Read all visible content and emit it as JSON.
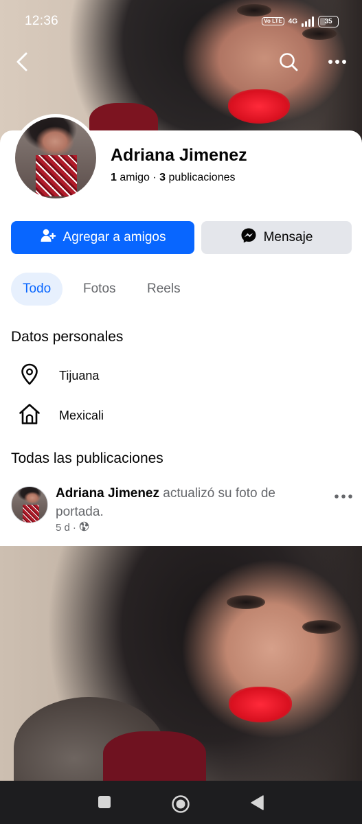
{
  "status_bar": {
    "time": "12:36",
    "volte": "Vo LTE",
    "network": "4G",
    "battery": "35",
    "battery_level": 0.35
  },
  "profile": {
    "name": "Adriana Jimenez",
    "friends_count": "1",
    "friends_label": "amigo",
    "separator": "·",
    "posts_count": "3",
    "posts_label": "publicaciones"
  },
  "actions": {
    "add_friend_label": "Agregar a amigos",
    "message_label": "Mensaje"
  },
  "tabs": [
    {
      "label": "Todo",
      "active": true
    },
    {
      "label": "Fotos",
      "active": false
    },
    {
      "label": "Reels",
      "active": false
    }
  ],
  "personal_details": {
    "title": "Datos personales",
    "items": [
      {
        "icon": "location-pin-icon",
        "text": "Tijuana"
      },
      {
        "icon": "home-icon",
        "text": "Mexicali"
      }
    ]
  },
  "posts_section": {
    "title": "Todas las publicaciones",
    "post": {
      "author": "Adriana Jimenez",
      "action": "actualizó su foto de portada.",
      "time": "5 d",
      "meta_separator": "·",
      "privacy_icon": "globe-icon"
    }
  },
  "colors": {
    "primary": "#0866ff",
    "secondary_button": "#e4e6eb",
    "tab_active_bg": "#e7f0fd",
    "muted_text": "#65676b"
  }
}
